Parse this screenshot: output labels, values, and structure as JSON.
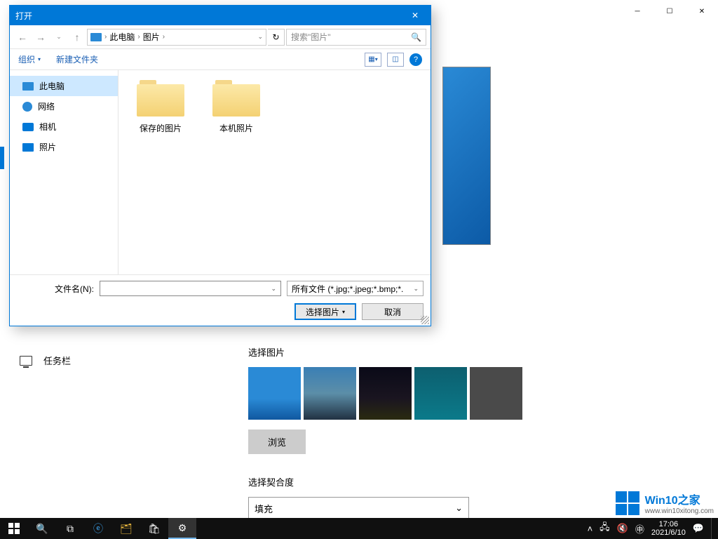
{
  "settings": {
    "sidebar": {
      "items": [
        {
          "label": "任务栏"
        }
      ]
    },
    "main": {
      "choose_picture_title": "选择图片",
      "browse_label": "浏览",
      "choose_fit_title": "选择契合度",
      "fit_value": "填充"
    }
  },
  "dialog": {
    "title": "打开",
    "breadcrumb": {
      "root": "此电脑",
      "folder": "图片"
    },
    "search_placeholder": "搜索\"图片\"",
    "toolbar": {
      "organize": "组织",
      "new_folder": "新建文件夹"
    },
    "tree": [
      {
        "label": "此电脑",
        "icon": "pc",
        "selected": true
      },
      {
        "label": "网络",
        "icon": "net",
        "selected": false
      },
      {
        "label": "相机",
        "icon": "cam",
        "selected": false
      },
      {
        "label": "照片",
        "icon": "pic",
        "selected": false
      }
    ],
    "folders": [
      {
        "label": "保存的图片"
      },
      {
        "label": "本机照片"
      }
    ],
    "filename_label": "文件名(N):",
    "type_filter": "所有文件 (*.jpg;*.jpeg;*.bmp;*.",
    "open_btn": "选择图片",
    "cancel_btn": "取消"
  },
  "taskbar": {
    "time": "17:06",
    "date": "2021/6/10"
  },
  "watermark": {
    "line1": "Win10之家",
    "line2": "www.win10xitong.com"
  }
}
